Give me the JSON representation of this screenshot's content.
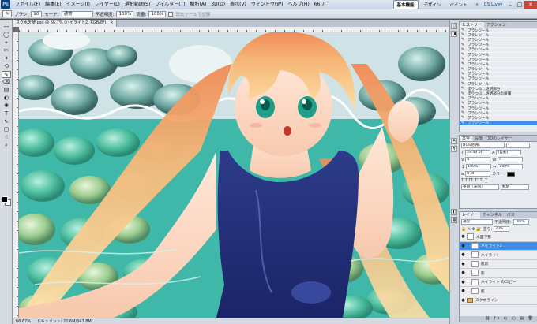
{
  "app": {
    "logo": "Ps"
  },
  "menu": [
    "ファイル(F)",
    "編集(E)",
    "イメージ(I)",
    "レイヤー(L)",
    "選択範囲(S)",
    "フィルター(T)",
    "解析(A)",
    "3D(D)",
    "表示(V)",
    "ウィンドウ(W)",
    "ヘルプ(H)"
  ],
  "menubar_right": {
    "zoom": "66.7",
    "workspaces": [
      "基本機能",
      "デザイン",
      "ペイント"
    ],
    "more": "»",
    "cslive": "CS Live▾",
    "win_min": "–",
    "win_max": "□",
    "win_close": "✕"
  },
  "options": {
    "tool_icon": "✎",
    "brush_label": "ブラシ:",
    "brush_size": "10",
    "mode_label": "モード:",
    "mode_value": "通常",
    "opacity_label": "不透明度:",
    "opacity_value": "100%",
    "flow_label": "流量:",
    "flow_value": "100%",
    "check_label": "消去ツールで記録"
  },
  "tools": [
    "▭",
    "◯",
    "⌖",
    "✂",
    "✦",
    "⟲",
    "✎",
    "⌫",
    "▤",
    "◐",
    "✺",
    "T",
    "↖",
    "▢",
    "☝",
    "⌕"
  ],
  "document": {
    "tab_title": "スク水天使.psd @ 66.7% (ハイライト2, RGB/8*)",
    "tab_close": "×",
    "status_zoom": "66.67%",
    "status_doc": "ドキュメント: 22.6M/347.8M"
  },
  "history": {
    "tabs": [
      "ヒストリー",
      "アクション"
    ],
    "items": [
      "ブラシツール",
      "ブラシツール",
      "ブラシツール",
      "ブラシツール",
      "ブラシツール",
      "ブラシツール",
      "ブラシツール",
      "ブラシツール",
      "ブラシツール",
      "ブラシツール",
      "ブラシツール",
      "ブラシツール",
      "塗りつぶし透明部分",
      "塗りつぶし透明部分の保護",
      "ブラシツール",
      "ブラシツール",
      "ブラシツール",
      "ブラシツール",
      "ブラシツール",
      "ブラシツール"
    ],
    "selected_index": 19
  },
  "character": {
    "tabs": [
      "文字",
      "段落",
      "3Dのレイヤー"
    ],
    "font": "HGS明朝E",
    "style": "-",
    "size": "29.43 pt",
    "leading": "(自動)",
    "kerning": "0",
    "tracking": "0",
    "vscale": "100%",
    "hscale": "100%",
    "baseline": "0 pt",
    "color_label": "カラー:",
    "lang": "英語（米国）",
    "aa": "鮮明"
  },
  "layers": {
    "tabs": [
      "レイヤー",
      "チャンネル",
      "パス"
    ],
    "blend": "通常",
    "opacity_label": "不透明度:",
    "opacity": "100%",
    "fill_label": "塗り:",
    "fill": "20%",
    "items": [
      {
        "name": "水面下影",
        "type": "layer"
      },
      {
        "name": "ハイライト2",
        "type": "layer",
        "selected": true
      },
      {
        "name": "ハイライト",
        "type": "layer"
      },
      {
        "name": "肌影",
        "type": "layer"
      },
      {
        "name": "影",
        "type": "layer"
      },
      {
        "name": "ハイライト のコピー",
        "type": "layer"
      },
      {
        "name": "肌",
        "type": "layer"
      },
      {
        "name": "スク水ライン",
        "type": "folder"
      }
    ],
    "bottom_icons": "⛓ fx ◐ ▢ ▤ 🗑"
  },
  "side_icons": [
    "◫",
    "◨",
    "A",
    "¶",
    "◧",
    "▦"
  ]
}
